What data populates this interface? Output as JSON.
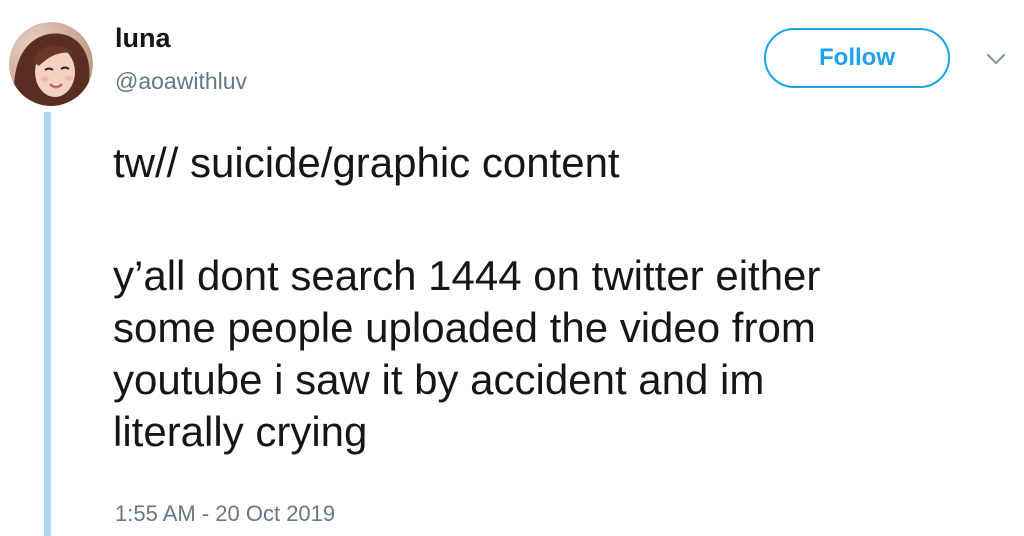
{
  "user": {
    "display_name": "luna",
    "handle": "@aoawithluv"
  },
  "actions": {
    "follow_label": "Follow",
    "menu_icon": "chevron-down-icon"
  },
  "tweet": {
    "warning_line": "tw// suicide/graphic content",
    "body_lines": [
      "y’all dont search 1444 on twitter either",
      "some people uploaded the video from",
      "youtube i saw it by accident and im",
      "literally crying"
    ],
    "timestamp": "1:55 AM - 20 Oct 2019"
  },
  "colors": {
    "accent": "#1da1f2",
    "thread_line": "#a8d7f4",
    "muted_text": "#657786",
    "primary_text": "#14171a"
  }
}
